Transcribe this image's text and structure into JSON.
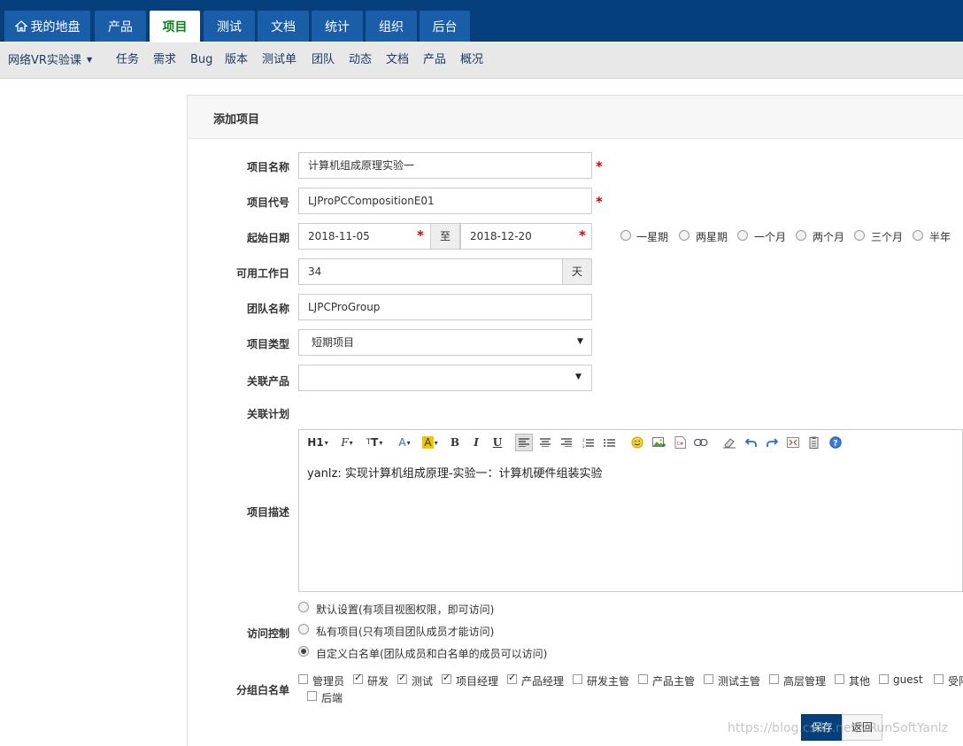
{
  "topnav": {
    "tabs": [
      "我的地盘",
      "产品",
      "项目",
      "测试",
      "文档",
      "统计",
      "组织",
      "后台"
    ],
    "active_index": 2
  },
  "subnav": {
    "project_switcher": "网络VR实验课",
    "items": [
      "任务",
      "需求",
      "Bug",
      "版本",
      "测试单",
      "团队",
      "动态",
      "文档",
      "产品",
      "概况"
    ]
  },
  "card": {
    "title": "添加项目"
  },
  "form": {
    "name_label": "项目名称",
    "name_value": "计算机组成原理实验一",
    "code_label": "项目代号",
    "code_value": "LJProPCCompositionE01",
    "date_label": "起始日期",
    "start_date": "2018-11-05",
    "date_sep": "至",
    "end_date": "2018-12-20",
    "durations": [
      "一星期",
      "两星期",
      "一个月",
      "两个月",
      "三个月",
      "半年"
    ],
    "days_label": "可用工作日",
    "days_value": "34",
    "days_unit": "天",
    "team_label": "团队名称",
    "team_value": "LJPCProGroup",
    "type_label": "项目类型",
    "type_value": "短期项目",
    "product_label": "关联产品",
    "product_value": "",
    "plan_label": "关联计划",
    "desc_label": "项目描述",
    "toolbar": [
      "H1",
      "F",
      "T",
      "A",
      "A",
      "B",
      "I",
      "U"
    ],
    "desc_value": "yanlz: 实现计算机组成原理-实验一：计算机硬件组装实验",
    "acl_label": "访问控制",
    "acl_options": [
      "默认设置(有项目视图权限，即可访问)",
      "私有项目(只有项目团队成员才能访问)",
      "自定义白名单(团队成员和白名单的成员可以访问)"
    ],
    "acl_selected": 2,
    "whitelist_label": "分组白名单",
    "groups": [
      {
        "name": "管理员",
        "checked": false
      },
      {
        "name": "研发",
        "checked": true
      },
      {
        "name": "测试",
        "checked": true
      },
      {
        "name": "项目经理",
        "checked": true
      },
      {
        "name": "产品经理",
        "checked": true
      },
      {
        "name": "研发主管",
        "checked": false
      },
      {
        "name": "产品主管",
        "checked": false
      },
      {
        "name": "测试主管",
        "checked": false
      },
      {
        "name": "高层管理",
        "checked": false
      },
      {
        "name": "其他",
        "checked": false
      },
      {
        "name": "guest",
        "checked": false
      },
      {
        "name": "受限",
        "checked": false
      },
      {
        "name": "后端",
        "checked": false
      }
    ],
    "save_label": "保存",
    "back_label": "返回"
  },
  "watermark": "https://blog.csdn.net/VRunSoftYanlz",
  "colors": {
    "nav_bg": "#05407d",
    "tab_bg": "#1a5ea9",
    "active_tab_text": "#0b7d1a",
    "primary_button": "#05407d",
    "required": "#dd0000"
  }
}
